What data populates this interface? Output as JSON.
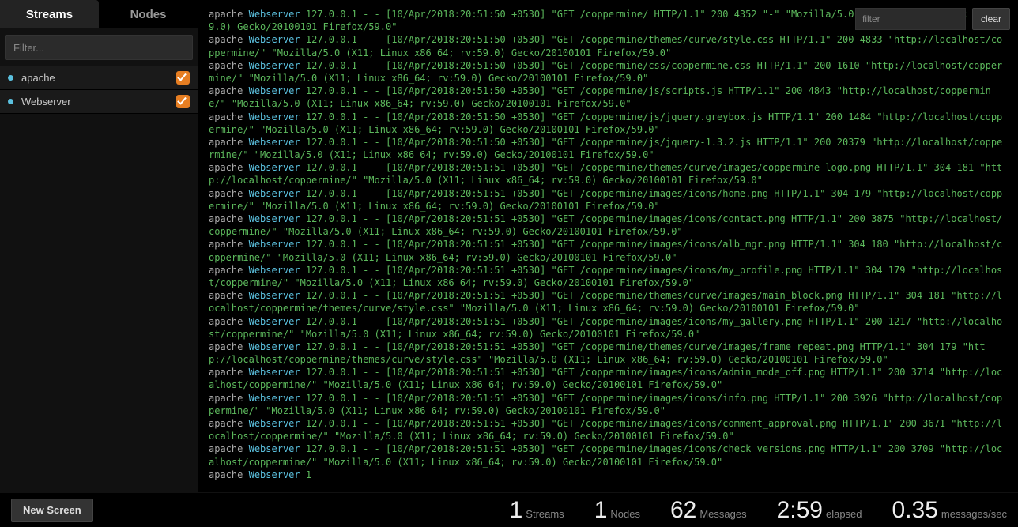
{
  "tabs": {
    "streams": "Streams",
    "nodes": "Nodes"
  },
  "sidebar": {
    "filter_placeholder": "Filter...",
    "items": [
      {
        "label": "apache",
        "checked": true
      },
      {
        "label": "Webserver",
        "checked": true
      }
    ]
  },
  "log_toolbar": {
    "filter_placeholder": "filter",
    "clear_label": "clear"
  },
  "footer": {
    "new_screen_label": "New Screen",
    "stats": [
      {
        "value": "1",
        "label": "Streams"
      },
      {
        "value": "1",
        "label": "Nodes"
      },
      {
        "value": "62",
        "label": "Messages"
      },
      {
        "value": "2:59",
        "label": "elapsed"
      },
      {
        "value": "0.35",
        "label": "messages/sec"
      }
    ]
  },
  "logs": [
    {
      "src": "apache",
      "name": "Webserver",
      "msg": "127.0.0.1 - - [10/Apr/2018:20:51:50 +0530] \"GET /coppermine/ HTTP/1.1\" 200 4352 \"-\" \"Mozilla/5.0 (X11; Linux x86_64; rv:59.0) Gecko/20100101 Firefox/59.0\""
    },
    {
      "src": "apache",
      "name": "Webserver",
      "msg": "127.0.0.1 - - [10/Apr/2018:20:51:50 +0530] \"GET /coppermine/themes/curve/style.css HTTP/1.1\" 200 4833 \"http://localhost/coppermine/\" \"Mozilla/5.0 (X11; Linux x86_64; rv:59.0) Gecko/20100101 Firefox/59.0\""
    },
    {
      "src": "apache",
      "name": "Webserver",
      "msg": "127.0.0.1 - - [10/Apr/2018:20:51:50 +0530] \"GET /coppermine/css/coppermine.css HTTP/1.1\" 200 1610 \"http://localhost/coppermine/\" \"Mozilla/5.0 (X11; Linux x86_64; rv:59.0) Gecko/20100101 Firefox/59.0\""
    },
    {
      "src": "apache",
      "name": "Webserver",
      "msg": "127.0.0.1 - - [10/Apr/2018:20:51:50 +0530] \"GET /coppermine/js/scripts.js HTTP/1.1\" 200 4843 \"http://localhost/coppermine/\" \"Mozilla/5.0 (X11; Linux x86_64; rv:59.0) Gecko/20100101 Firefox/59.0\""
    },
    {
      "src": "apache",
      "name": "Webserver",
      "msg": "127.0.0.1 - - [10/Apr/2018:20:51:50 +0530] \"GET /coppermine/js/jquery.greybox.js HTTP/1.1\" 200 1484 \"http://localhost/coppermine/\" \"Mozilla/5.0 (X11; Linux x86_64; rv:59.0) Gecko/20100101 Firefox/59.0\""
    },
    {
      "src": "apache",
      "name": "Webserver",
      "msg": "127.0.0.1 - - [10/Apr/2018:20:51:50 +0530] \"GET /coppermine/js/jquery-1.3.2.js HTTP/1.1\" 200 20379 \"http://localhost/coppermine/\" \"Mozilla/5.0 (X11; Linux x86_64; rv:59.0) Gecko/20100101 Firefox/59.0\""
    },
    {
      "src": "apache",
      "name": "Webserver",
      "msg": "127.0.0.1 - - [10/Apr/2018:20:51:51 +0530] \"GET /coppermine/themes/curve/images/coppermine-logo.png HTTP/1.1\" 304 181 \"http://localhost/coppermine/\" \"Mozilla/5.0 (X11; Linux x86_64; rv:59.0) Gecko/20100101 Firefox/59.0\""
    },
    {
      "src": "apache",
      "name": "Webserver",
      "msg": "127.0.0.1 - - [10/Apr/2018:20:51:51 +0530] \"GET /coppermine/images/icons/home.png HTTP/1.1\" 304 179 \"http://localhost/coppermine/\" \"Mozilla/5.0 (X11; Linux x86_64; rv:59.0) Gecko/20100101 Firefox/59.0\""
    },
    {
      "src": "apache",
      "name": "Webserver",
      "msg": "127.0.0.1 - - [10/Apr/2018:20:51:51 +0530] \"GET /coppermine/images/icons/contact.png HTTP/1.1\" 200 3875 \"http://localhost/coppermine/\" \"Mozilla/5.0 (X11; Linux x86_64; rv:59.0) Gecko/20100101 Firefox/59.0\""
    },
    {
      "src": "apache",
      "name": "Webserver",
      "msg": "127.0.0.1 - - [10/Apr/2018:20:51:51 +0530] \"GET /coppermine/images/icons/alb_mgr.png HTTP/1.1\" 304 180 \"http://localhost/coppermine/\" \"Mozilla/5.0 (X11; Linux x86_64; rv:59.0) Gecko/20100101 Firefox/59.0\""
    },
    {
      "src": "apache",
      "name": "Webserver",
      "msg": "127.0.0.1 - - [10/Apr/2018:20:51:51 +0530] \"GET /coppermine/images/icons/my_profile.png HTTP/1.1\" 304 179 \"http://localhost/coppermine/\" \"Mozilla/5.0 (X11; Linux x86_64; rv:59.0) Gecko/20100101 Firefox/59.0\""
    },
    {
      "src": "apache",
      "name": "Webserver",
      "msg": "127.0.0.1 - - [10/Apr/2018:20:51:51 +0530] \"GET /coppermine/themes/curve/images/main_block.png HTTP/1.1\" 304 181 \"http://localhost/coppermine/themes/curve/style.css\" \"Mozilla/5.0 (X11; Linux x86_64; rv:59.0) Gecko/20100101 Firefox/59.0\""
    },
    {
      "src": "apache",
      "name": "Webserver",
      "msg": "127.0.0.1 - - [10/Apr/2018:20:51:51 +0530] \"GET /coppermine/images/icons/my_gallery.png HTTP/1.1\" 200 1217 \"http://localhost/coppermine/\" \"Mozilla/5.0 (X11; Linux x86_64; rv:59.0) Gecko/20100101 Firefox/59.0\""
    },
    {
      "src": "apache",
      "name": "Webserver",
      "msg": "127.0.0.1 - - [10/Apr/2018:20:51:51 +0530] \"GET /coppermine/themes/curve/images/frame_repeat.png HTTP/1.1\" 304 179 \"http://localhost/coppermine/themes/curve/style.css\" \"Mozilla/5.0 (X11; Linux x86_64; rv:59.0) Gecko/20100101 Firefox/59.0\""
    },
    {
      "src": "apache",
      "name": "Webserver",
      "msg": "127.0.0.1 - - [10/Apr/2018:20:51:51 +0530] \"GET /coppermine/images/icons/admin_mode_off.png HTTP/1.1\" 200 3714 \"http://localhost/coppermine/\" \"Mozilla/5.0 (X11; Linux x86_64; rv:59.0) Gecko/20100101 Firefox/59.0\""
    },
    {
      "src": "apache",
      "name": "Webserver",
      "msg": "127.0.0.1 - - [10/Apr/2018:20:51:51 +0530] \"GET /coppermine/images/icons/info.png HTTP/1.1\" 200 3926 \"http://localhost/coppermine/\" \"Mozilla/5.0 (X11; Linux x86_64; rv:59.0) Gecko/20100101 Firefox/59.0\""
    },
    {
      "src": "apache",
      "name": "Webserver",
      "msg": "127.0.0.1 - - [10/Apr/2018:20:51:51 +0530] \"GET /coppermine/images/icons/comment_approval.png HTTP/1.1\" 200 3671 \"http://localhost/coppermine/\" \"Mozilla/5.0 (X11; Linux x86_64; rv:59.0) Gecko/20100101 Firefox/59.0\""
    },
    {
      "src": "apache",
      "name": "Webserver",
      "msg": "127.0.0.1 - - [10/Apr/2018:20:51:51 +0530] \"GET /coppermine/images/icons/check_versions.png HTTP/1.1\" 200 3709 \"http://localhost/coppermine/\" \"Mozilla/5.0 (X11; Linux x86_64; rv:59.0) Gecko/20100101 Firefox/59.0\""
    },
    {
      "src": "apache",
      "name": "Webserver",
      "msg": "1"
    }
  ]
}
